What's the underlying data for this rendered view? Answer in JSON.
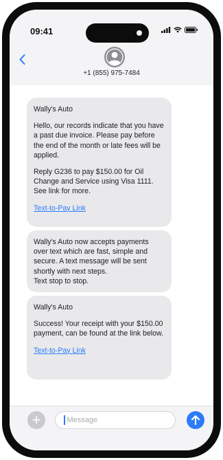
{
  "status_bar": {
    "time": "09:41"
  },
  "contact": {
    "phone_number": "+1 (855) 975-7484"
  },
  "messages": [
    {
      "paragraphs": [
        "Wally's Auto",
        "Hello, our records indicate that you have a past due invoice. Please pay before the end of the month or late fees will be applied.",
        "Reply G236 to pay $150.00 for Oil Change and Service using Visa 1111. See link for more."
      ],
      "link": "Text-to-Pay Link"
    },
    {
      "paragraphs": [
        "Wally's Auto now accepts payments over text which are fast, simple and secure. A text message will be sent shortly with next steps.",
        "Text stop to stop."
      ]
    },
    {
      "paragraphs": [
        "Wally's Auto",
        "Success! Your receipt with your $150.00 payment, can be found at the link below."
      ],
      "link": "Text-to-Pay Link"
    }
  ],
  "composer": {
    "placeholder": "Message"
  },
  "icons": {
    "back": "chevron-left-icon",
    "avatar": "person-avatar-icon",
    "add": "plus-icon",
    "send": "arrow-up-icon",
    "signal": "signal-icon",
    "wifi": "wifi-icon",
    "battery": "battery-icon"
  },
  "colors": {
    "accent": "#2b7cf6",
    "bubble": "#e9e9eb",
    "frame": "#0c0c0c"
  }
}
